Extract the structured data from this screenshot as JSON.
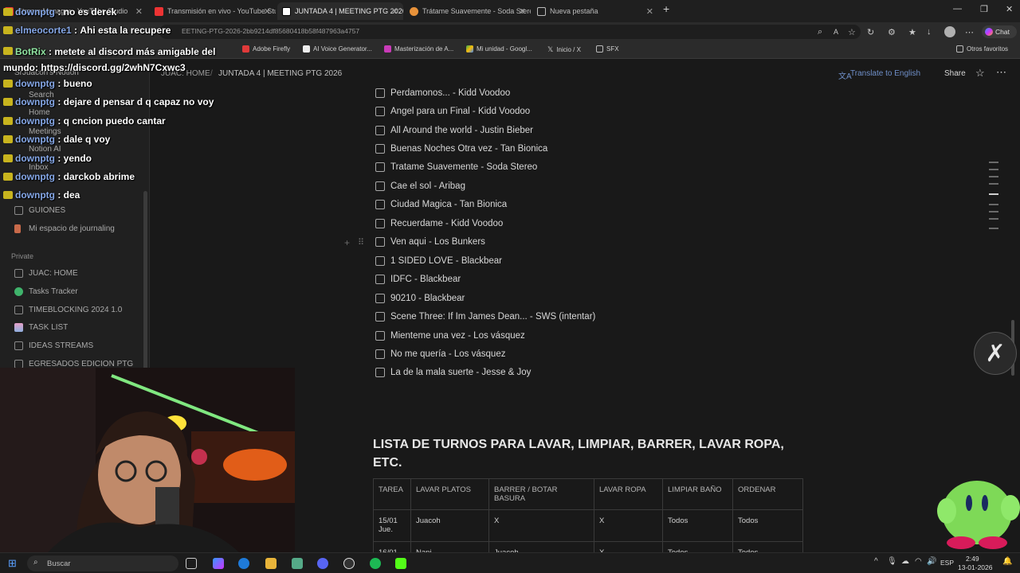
{
  "browser": {
    "tabs": [
      {
        "label": "Stream Manager - YouTube Studio",
        "active": false
      },
      {
        "label": "Transmisión en vivo - YouTube Stu",
        "active": false
      },
      {
        "label": "JUNTADA 4 | MEETING PTG 2026",
        "active": true
      },
      {
        "label": "Trátame Suavemente - Soda Stere",
        "active": false
      },
      {
        "label": "Nueva pestaña",
        "active": false
      }
    ],
    "url": "EETING-PTG-2026-2bb9214df85680418b58f487963a4757",
    "bookmarks": [
      "Adobe Firefly",
      "AI Voice Generator...",
      "Masterización de A...",
      "Mi unidad - Googl...",
      "Inicio / X",
      "SFX"
    ],
    "other_bookmarks": "Otros favoritos",
    "chat_button": "Chat"
  },
  "notion": {
    "breadcrumb": [
      "JUAC: HOME",
      "JUNTADA 4 | MEETING PTG 2026"
    ],
    "translate": "Translate to English",
    "share": "Share",
    "sidebar": {
      "workspace": "SrJuacoh's Notion",
      "search": "Search",
      "home": "Home",
      "meetings": "Meetings",
      "notion_ai": "Notion AI",
      "inbox": "Inbox",
      "items_top": [
        "GUIONES",
        "Mi espacio de journaling"
      ],
      "private_label": "Private",
      "private_items": [
        "JUAC: HOME",
        "Tasks Tracker",
        "TIMEBLOCKING 2024 1.0",
        "TASK LIST",
        "IDEAS STREAMS",
        "EGRESADOS EDICION PTG"
      ]
    },
    "songs": [
      "Perdamonos... - Kidd Voodoo",
      "Angel para un Final - Kidd Voodoo",
      "All Around the world - Justin Bieber",
      "Buenas Noches Otra vez - Tan Bionica",
      "Tratame Suavemente - Soda Stereo",
      "Cae el sol - Aribag",
      "Ciudad Magica - Tan Bionica",
      "Recuerdame - Kidd Voodoo",
      "Ven aqui - Los Bunkers",
      "1 SIDED LOVE - Blackbear",
      "IDFC - Blackbear",
      "90210 - Blackbear",
      "Scene Three: If Im James Dean... - SWS (intentar)",
      "Mienteme una vez - Los vásquez",
      "No me quería - Los vásquez",
      "La de la mala suerte - Jesse & Joy"
    ],
    "heading": "LISTA DE TURNOS PARA LAVAR, LIMPIAR, BARRER, LAVAR ROPA, ETC.",
    "table": {
      "headers": [
        "TAREA",
        "LAVAR PLATOS",
        "BARRER / BOTAR BASURA",
        "LAVAR ROPA",
        "LIMPIAR BAÑO",
        "ORDENAR"
      ],
      "rows": [
        [
          "15/01 Jue.",
          "Juacoh",
          "X",
          "X",
          "Todos",
          "Todos"
        ],
        [
          "16/01",
          "Nani",
          "Juacoh",
          "X",
          "Todos",
          "Todos"
        ]
      ]
    }
  },
  "chat": [
    {
      "user": "downptg",
      "msg": "no es derek"
    },
    {
      "user": "elmeocorte1",
      "msg": "Ahi esta la recupere"
    },
    {
      "user": "BotRix",
      "msg": "metete al discord más amigable del mundo: https://discord.gg/2whN7Cxwc3"
    },
    {
      "user": "downptg",
      "msg": "bueno"
    },
    {
      "user": "downptg",
      "msg": "dejare d pensar d q capaz no voy"
    },
    {
      "user": "downptg",
      "msg": "q cncion puedo cantar"
    },
    {
      "user": "downptg",
      "msg": "dale q voy"
    },
    {
      "user": "downptg",
      "msg": "yendo"
    },
    {
      "user": "downptg",
      "msg": "darckob abrime"
    },
    {
      "user": "downptg",
      "msg": "dea"
    }
  ],
  "taskbar": {
    "search": "Buscar",
    "lang": "ESP",
    "time": "2:49",
    "date": "13-01-2026"
  }
}
